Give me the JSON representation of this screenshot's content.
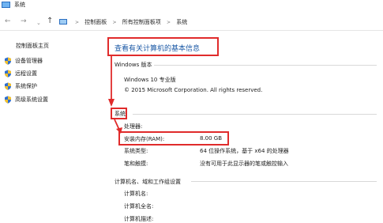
{
  "window": {
    "title": "系统"
  },
  "addressbar": {
    "back_glyph": "←",
    "forward_glyph": "→",
    "dropdown_glyph": "⌄",
    "up_glyph": "↑",
    "crumbs": [
      "控制面板",
      "所有控制面板项",
      "系统"
    ],
    "separator": ">"
  },
  "sidebar": {
    "home_label": "控制面板主页",
    "items": [
      {
        "label": "设备管理器",
        "icon": "shield-icon"
      },
      {
        "label": "远程设置",
        "icon": "shield-icon"
      },
      {
        "label": "系统保护",
        "icon": "shield-icon"
      },
      {
        "label": "高级系统设置",
        "icon": "shield-icon"
      }
    ]
  },
  "main": {
    "heading": "查看有关计算机的基本信息",
    "windows_edition": {
      "section_title": "Windows 版本",
      "edition": "Windows 10 专业版",
      "copyright": "© 2015 Microsoft Corporation. All rights reserved."
    },
    "system": {
      "section_title": "系统",
      "rows": [
        {
          "label": "处理器:",
          "value": ""
        },
        {
          "label": "安装内存(RAM):",
          "value": "8.00 GB"
        },
        {
          "label": "系统类型:",
          "value": "64 位操作系统，基于 x64 的处理器"
        },
        {
          "label": "笔和触摸:",
          "value": "没有可用于此显示器的笔或触控输入"
        }
      ]
    },
    "computer": {
      "section_title": "计算机名、域和工作组设置",
      "rows": [
        {
          "label": "计算机名:"
        },
        {
          "label": "计算机全名:"
        },
        {
          "label": "计算机描述:"
        }
      ]
    }
  },
  "colors": {
    "highlight": "#e02b2b",
    "heading_blue": "#1c5aa6"
  }
}
